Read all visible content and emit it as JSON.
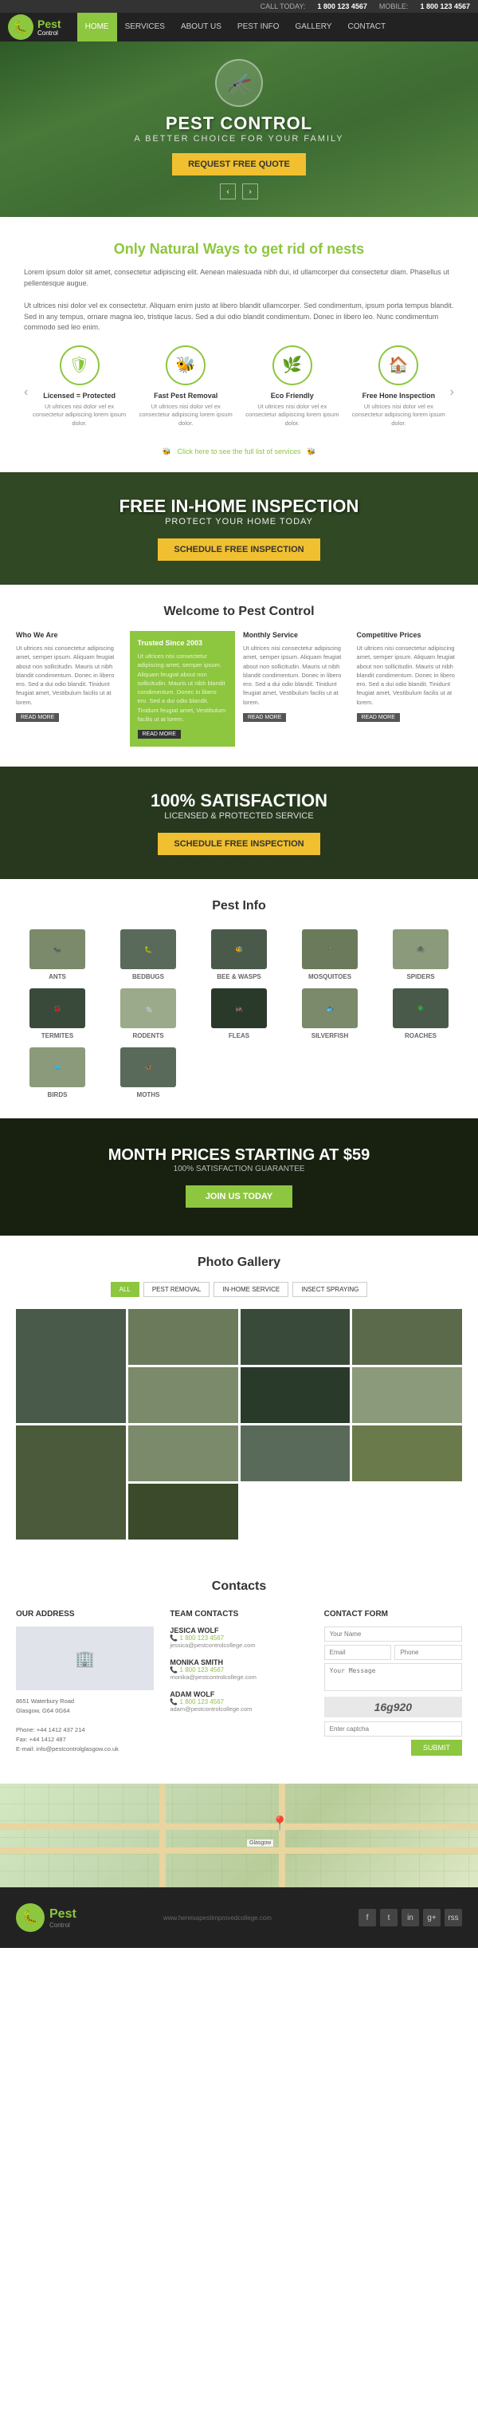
{
  "topbar": {
    "call_label": "CALL TODAY:",
    "call_number": "1 800 123 4567",
    "mobile_label": "MOBILE:",
    "mobile_number": "1 800 123 4567"
  },
  "nav": {
    "logo_text": "Pest",
    "logo_sub": "Control",
    "items": [
      {
        "label": "Home",
        "active": true
      },
      {
        "label": "Services",
        "active": false
      },
      {
        "label": "About Us",
        "active": false
      },
      {
        "label": "Pest Info",
        "active": false
      },
      {
        "label": "Gallery",
        "active": false
      },
      {
        "label": "Contact",
        "active": false
      }
    ]
  },
  "hero": {
    "title": "PEST CONTROL",
    "subtitle": "A BETTER CHOICE FOR YOUR FAMILY",
    "cta": "Request Free Quote"
  },
  "natural_ways": {
    "heading_start": "Only ",
    "heading_highlight": "Natural Ways",
    "heading_end": " to get rid of nests",
    "intro": "Lorem ipsum dolor sit amet, consectetur adipiscing elit. Aenean malesuada nibh dui, id ullamcorper dui consectetur diam. Phasellus ut pellentesque augue.",
    "detail": "Ut ultrices nisi dolor vel ex consectetur. Aliquam enim justo at libero blandit ullamcorper. Sed condimentum, ipsum porta tempus blandit. Sed in any tempus, ornare magna leo, tristique lacus. Sed a dui odio blandit condimentum. Donec in libero leo. Nunc condimentum commodo sed leo enim.",
    "features": [
      {
        "icon": "🛡",
        "title": "Licensed = Protected",
        "desc": "Ut ultrices nisi dolor vel ex consectetur adipiscing lorem ipsum dolor."
      },
      {
        "icon": "🐝",
        "title": "Fast Pest Removal",
        "desc": "Ut ultrices nisi dolor vel ex consectetur adipiscing lorem ipsum dolor."
      },
      {
        "icon": "🌿",
        "title": "Eco Friendly",
        "desc": "Ut ultrices nisi dolor vel ex consectetur adipiscing lorem ipsum dolor."
      },
      {
        "icon": "🏠",
        "title": "Free Hone Inspection",
        "desc": "Ut ultrices nisi dolor vel ex consectetur adipiscing lorem ipsum dolor."
      }
    ],
    "services_link": "Click here to see the full list of services"
  },
  "inspection_banner": {
    "line1": "FREE IN-HOME INSPECTION",
    "line2": "PROTECT YOUR HOME TODAY",
    "cta": "Schedule Free Inspection"
  },
  "welcome": {
    "title": "Welcome to Pest Control",
    "columns": [
      {
        "title": "Who We Are",
        "text": "Ut ultrices nisi consectetur adipiscing amet, semper ipsum. Aliquam feugiat about non sollicitudin. Mauris ut nibh blandit condimentum. Donec in libero ero. Sed a dui odio blandit. Tinidunt feugiat amet, Vestibulum facilis ut at lorem.",
        "green": false
      },
      {
        "title": "Trusted Since 2003",
        "text": "Ut ultrices nisi consectetur adipiscing amet, semper ipsum. Aliquam feugiat about non sollicitudin. Mauris ut nibh blandit condimentum. Donec in libero ero. Sed a dui odio blandit. Tinidunt feugiat amet, Vestibulum facilis ut at lorem.",
        "green": true
      },
      {
        "title": "Monthly Service",
        "text": "Ut ultrices nisi consectetur adipiscing amet, semper ipsum. Aliquam feugiat about non sollicitudin. Mauris ut nibh blandit condimentum. Donec in libero ero. Sed a dui odio blandit. Tinidunt feugiat amet, Vestibulum facilis ut at lorem.",
        "green": false
      },
      {
        "title": "Competitive Prices",
        "text": "Ut ultrices nisi consectetur adipiscing amet, semper ipsum. Aliquam feugiat about non sollicitudin. Mauris ut nibh blandit condimentum. Donec in libero ero. Sed a dui odio blandit. Tinidunt feugiat amet, Vestibulum facilis ut at lorem.",
        "green": false
      }
    ],
    "read_more": "READ MORE"
  },
  "satisfaction_banner": {
    "line1": "100% SATISFACTION",
    "line2": "LICENSED & PROTECTED SERVICE",
    "cta": "Schedule Free Inspection"
  },
  "pest_info": {
    "title": "Pest Info",
    "pests": [
      {
        "name": "ANTS",
        "emoji": "🐜"
      },
      {
        "name": "BEDBUGS",
        "emoji": "🐛"
      },
      {
        "name": "BEE & WASPS",
        "emoji": "🐝"
      },
      {
        "name": "MOSQUITOES",
        "emoji": "🦟"
      },
      {
        "name": "SPIDERS",
        "emoji": "🕷"
      },
      {
        "name": "TERMITES",
        "emoji": "🐞"
      },
      {
        "name": "RODENTS",
        "emoji": "🐀"
      },
      {
        "name": "FLEAS",
        "emoji": "🦗"
      },
      {
        "name": "SILVERFISH",
        "emoji": "🐟"
      },
      {
        "name": "ROACHES",
        "emoji": "🪲"
      },
      {
        "name": "BIRDS",
        "emoji": "🐦"
      },
      {
        "name": "MOTHS",
        "emoji": "🦋"
      }
    ]
  },
  "prices_banner": {
    "line1": "MONTH PRICES STARTING AT $59",
    "line2": "100% SATISFACTION GUARANTEE",
    "cta": "Join Us Today"
  },
  "gallery": {
    "title": "Photo Gallery",
    "tabs": [
      "ALL",
      "PEST REMOVAL",
      "IN-HOME SERVICE",
      "INSECT SPRAYING"
    ],
    "active_tab": 0
  },
  "contacts": {
    "title": "Contacts",
    "address_col": {
      "title": "OUR ADDRESS",
      "lines": [
        "8651 Waterbury Road",
        "Glasgow, G64 0G64",
        "",
        "Phone: +44 1412 437 214",
        "Fax: +44 1412 487",
        "E-mail: info@pestcontrolglasgow.co.uk"
      ]
    },
    "team_col": {
      "title": "TEAM CONTACTS",
      "members": [
        {
          "name": "JESICA WOLF",
          "phone": "1 800 123 4567",
          "email": "jessica@pestcontrolcollege.com"
        },
        {
          "name": "MONIKA SMITH",
          "phone": "1 800 123 4567",
          "email": "monika@pestcontrolcollege.com"
        },
        {
          "name": "ADAM WOLF",
          "phone": "1 800 123 4567",
          "email": "adam@pestcontrolcollege.com"
        }
      ]
    },
    "form_col": {
      "title": "CONTACT FORM",
      "fields": {
        "name_placeholder": "Your Name",
        "email_placeholder": "Email",
        "phone_placeholder": "Phone",
        "message_placeholder": "Your Message",
        "captcha": "16g920",
        "captcha_placeholder": "Enter captcha",
        "submit": "SUBMIT"
      }
    }
  },
  "footer": {
    "logo_text": "Pest",
    "logo_sub": "Control",
    "url": "www.hereisapestimprovedcollege.com",
    "social_icons": [
      "f",
      "t",
      "in",
      "g+",
      "rss"
    ]
  }
}
